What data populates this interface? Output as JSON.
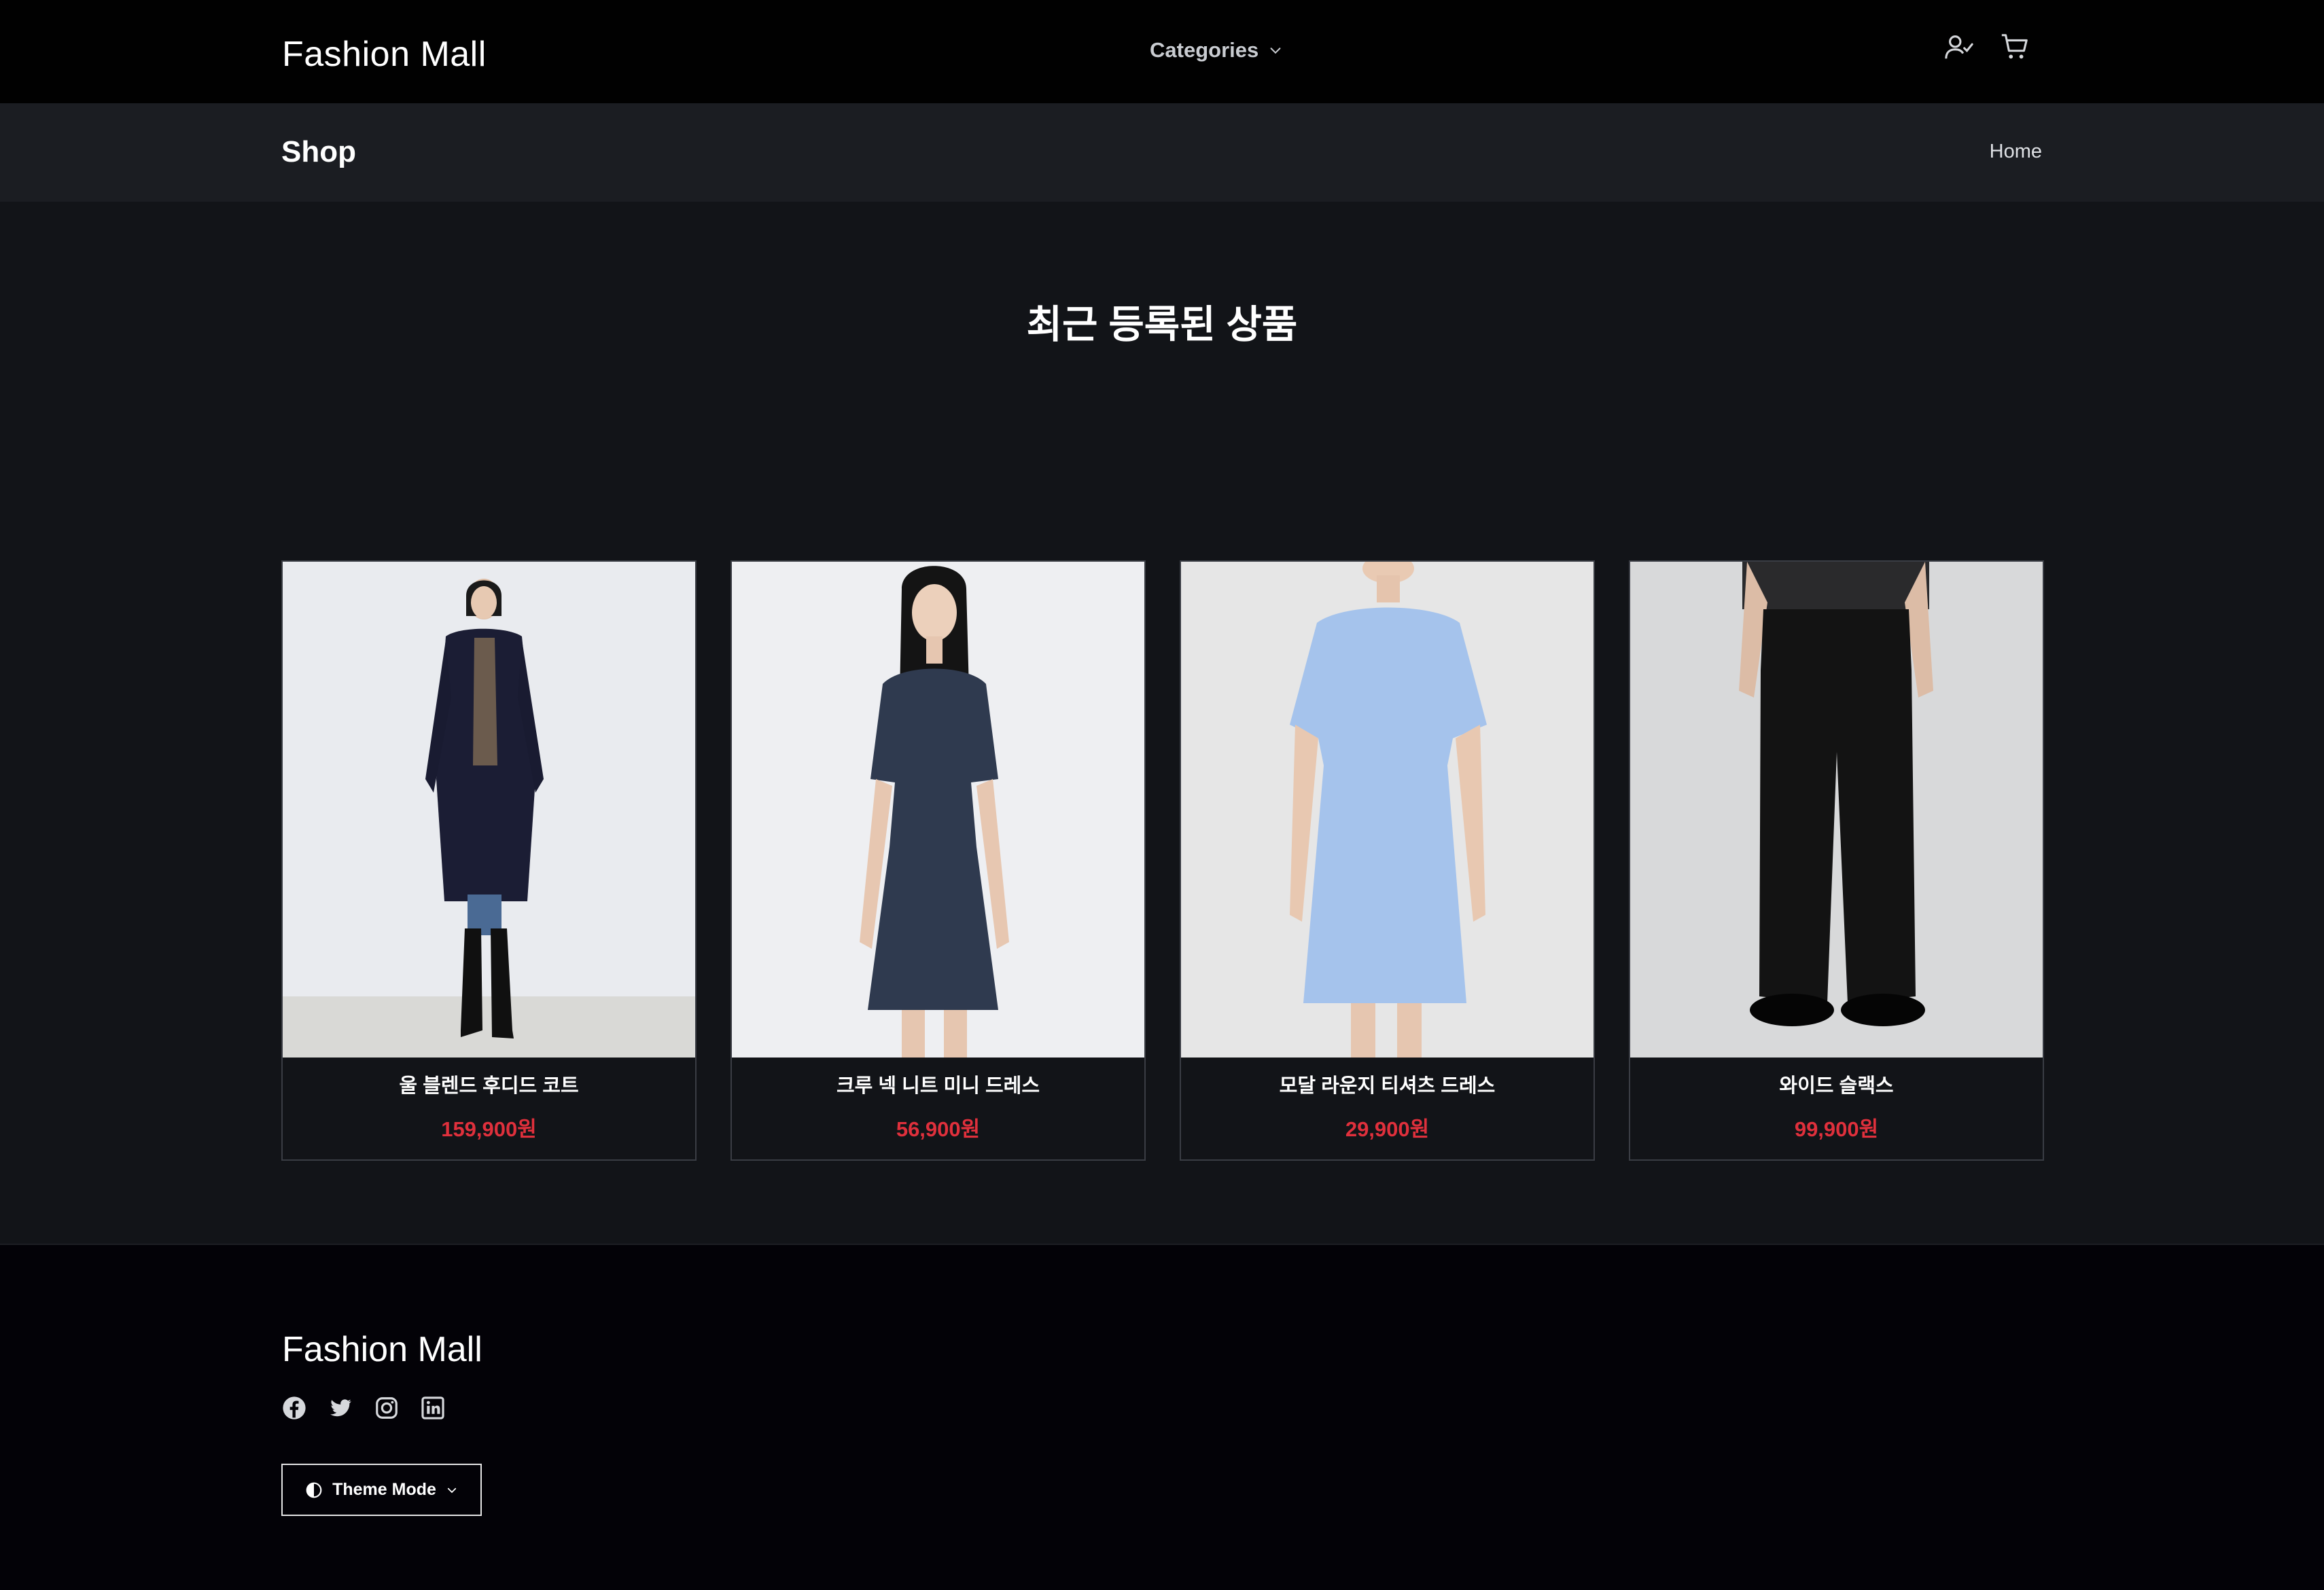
{
  "header": {
    "brand": "Fashion Mall",
    "categories_label": "Categories",
    "icons": [
      "user-check-icon",
      "cart-icon"
    ]
  },
  "shop_bar": {
    "title": "Shop",
    "breadcrumb": "Home"
  },
  "main": {
    "section_title": "최근 등록된 상품",
    "products": [
      {
        "name": "울 블렌드 후디드 코트",
        "price": "159,900원",
        "image": "model-navy-hooded-coat"
      },
      {
        "name": "크루 넥 니트 미니 드레스",
        "price": "56,900원",
        "image": "model-navy-knit-dress"
      },
      {
        "name": "모달 라운지 티셔츠 드레스",
        "price": "29,900원",
        "image": "model-light-blue-tshirt-dress"
      },
      {
        "name": "와이드 슬랙스",
        "price": "99,900원",
        "image": "model-black-wide-slacks"
      }
    ]
  },
  "footer": {
    "brand": "Fashion Mall",
    "social_icons": [
      "facebook-icon",
      "twitter-icon",
      "instagram-icon",
      "linkedin-icon"
    ],
    "theme_button_label": "Theme Mode"
  },
  "colors": {
    "page_bg": "#121418",
    "topbar_bg": "#010101",
    "shopbar_bg": "#1b1d22",
    "footer_bg": "#030207",
    "price": "#e0303c"
  }
}
